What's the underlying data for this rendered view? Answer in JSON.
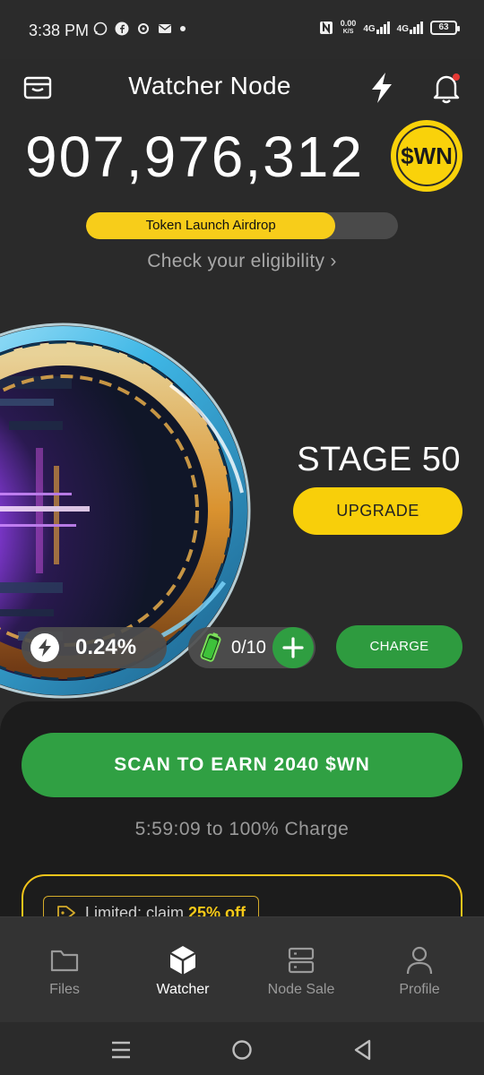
{
  "status_bar": {
    "time": "3:38 PM",
    "net_speed_value": "0.00",
    "net_speed_unit": "K/S",
    "signal1": "4G",
    "signal2": "4G",
    "battery": "63"
  },
  "header": {
    "title": "Watcher Node"
  },
  "balance": {
    "amount": "907,976,312",
    "token": "$WN"
  },
  "airdrop": {
    "label": "Token Launch Airdrop",
    "progress": 0.8,
    "eligibility_link": "Check your eligibility ›"
  },
  "stage": {
    "label": "STAGE 50",
    "upgrade_label": "UPGRADE"
  },
  "stats": {
    "rate": "0.24%",
    "charges": "0/10",
    "charge_label": "CHARGE"
  },
  "scan": {
    "button_label": "SCAN TO EARN 2040 $WN",
    "timer_text": "5:59:09  to 100% Charge"
  },
  "promo": {
    "prefix": "Limited: claim ",
    "highlight": "25% off"
  },
  "bottom_nav": {
    "items": [
      {
        "label": "Files",
        "icon": "folder-icon"
      },
      {
        "label": "Watcher",
        "icon": "cube-icon",
        "active": true
      },
      {
        "label": "Node Sale",
        "icon": "server-icon"
      },
      {
        "label": "Profile",
        "icon": "person-icon"
      }
    ]
  },
  "colors": {
    "background": "#2a2a2a",
    "accent_yellow": "#f8cf0a",
    "accent_green": "#30a043",
    "sheet": "#1c1c1c",
    "nav": "#333333"
  }
}
